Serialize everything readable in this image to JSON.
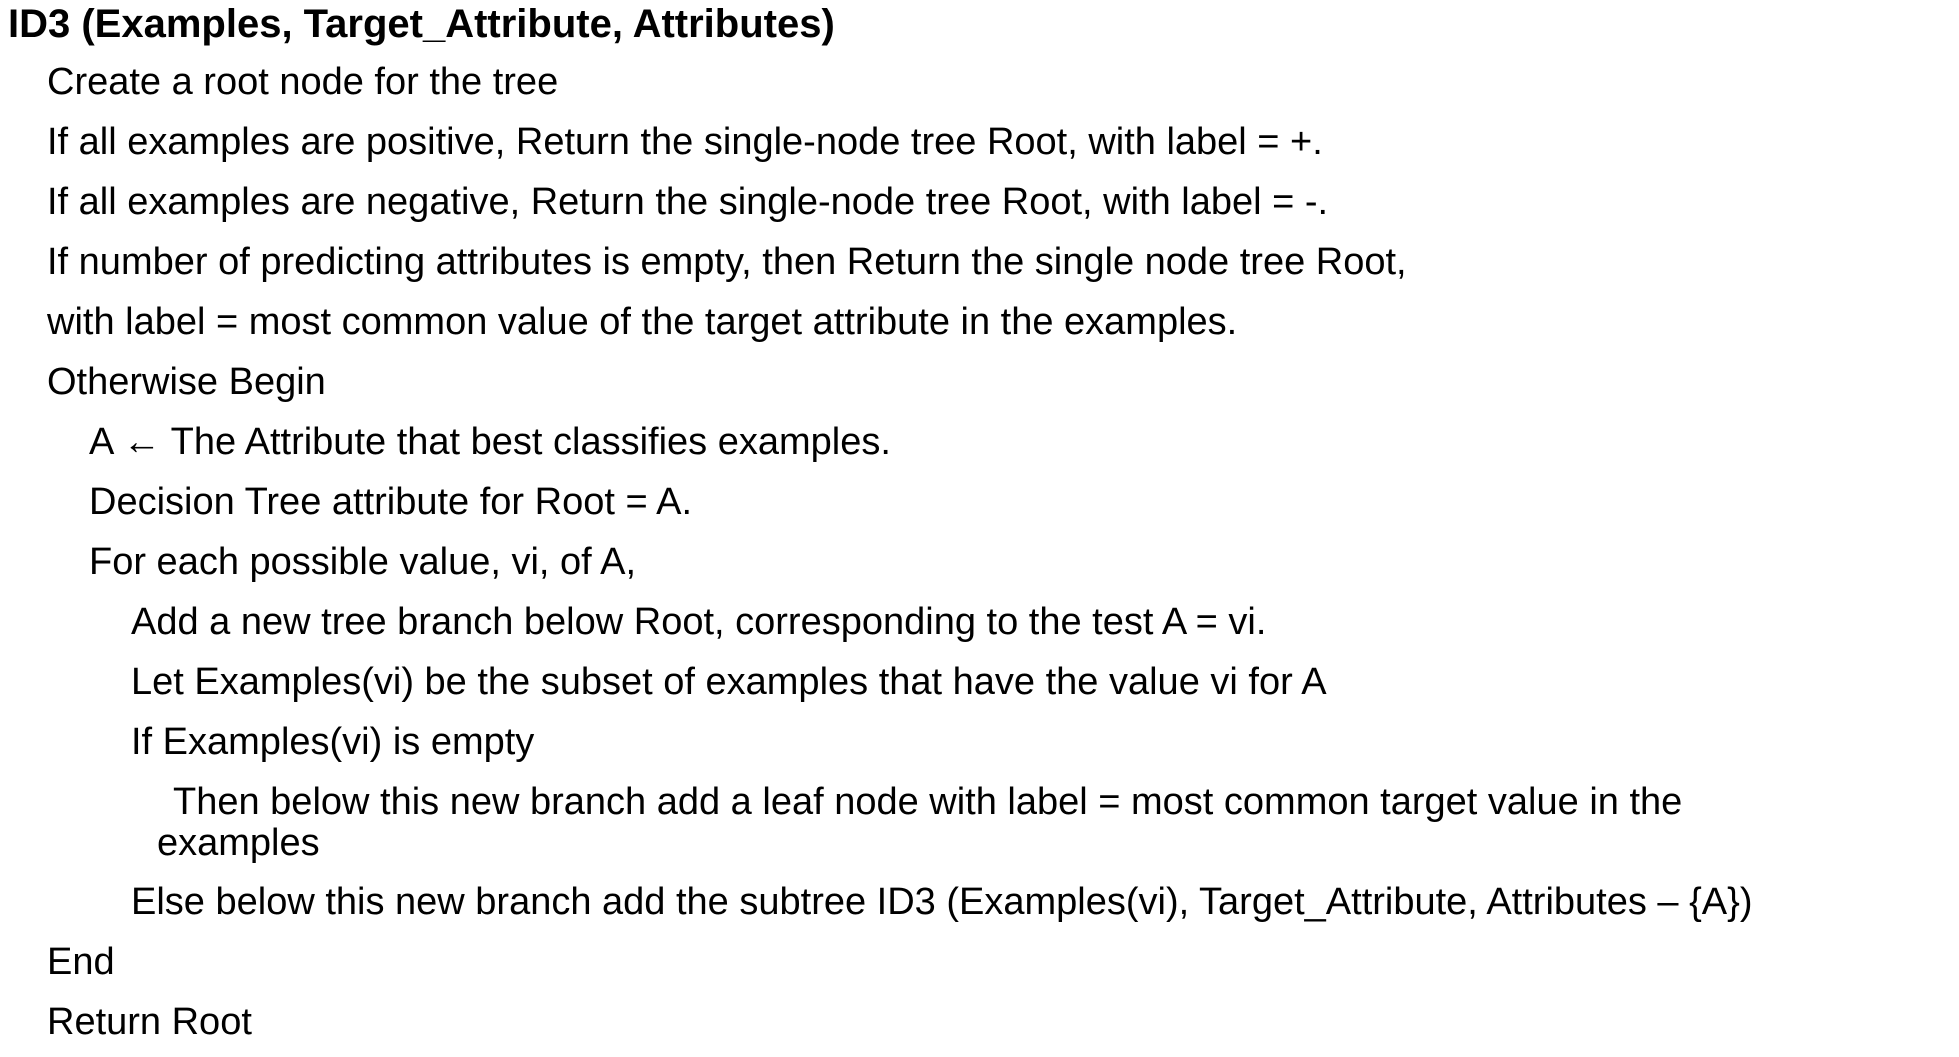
{
  "title": "ID3 (Examples, Target_Attribute, Attributes)",
  "lines": [
    "Create a root node for the tree",
    "If all examples are positive, Return the single-node tree Root, with label = +.",
    "If all examples are negative, Return the single-node tree Root, with label = -.",
    "If number of predicting attributes is empty, then Return the single node tree Root,",
    "with label = most common value of the target attribute in the examples.",
    "Otherwise Begin",
    "A ← The Attribute that best classifies examples.",
    "Decision Tree attribute for Root = A.",
    "For each possible value, vi, of A,",
    "Add a new tree branch below Root, corresponding to the test A = vi.",
    "Let Examples(vi) be the subset of examples that have the value vi for A",
    "If Examples(vi) is empty",
    "Then below this new branch add a leaf node with label = most common target value in the",
    "examples",
    "Else below this new branch add the subtree ID3 (Examples(vi), Target_Attribute, Attributes – {A})",
    "End",
    "Return Root"
  ]
}
